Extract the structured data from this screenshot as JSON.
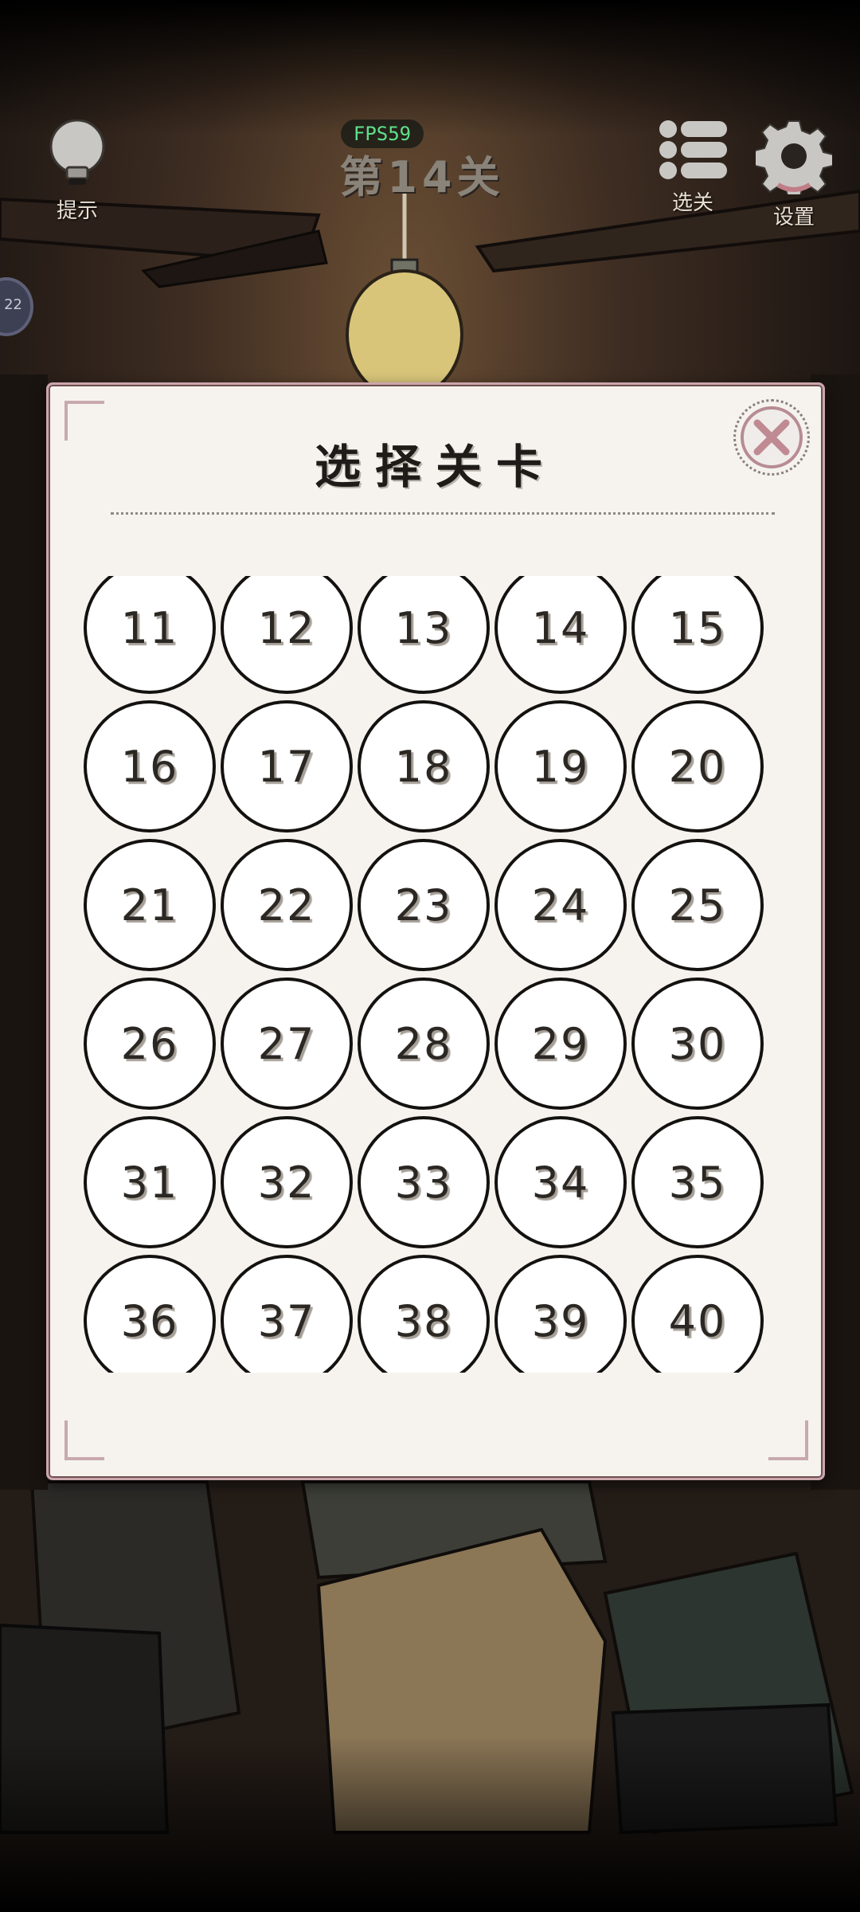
{
  "hud": {
    "hint_label": "提示",
    "fps": "FPS59",
    "level_title": "第14关",
    "level_select_label": "选关",
    "settings_label": "设置",
    "side_tab_text": "22"
  },
  "dialog": {
    "title": "选择关卡",
    "close_icon": "close-icon",
    "levels": [
      "11",
      "12",
      "13",
      "14",
      "15",
      "16",
      "17",
      "18",
      "19",
      "20",
      "21",
      "22",
      "23",
      "24",
      "25",
      "26",
      "27",
      "28",
      "29",
      "30",
      "31",
      "32",
      "33",
      "34",
      "35",
      "36",
      "37",
      "38",
      "39",
      "40"
    ]
  },
  "colors": {
    "dialog_bg": "#f6f3ee",
    "dialog_border": "#cba6ad",
    "close_accent": "#b78c93",
    "fps_green": "#5fe08a"
  }
}
